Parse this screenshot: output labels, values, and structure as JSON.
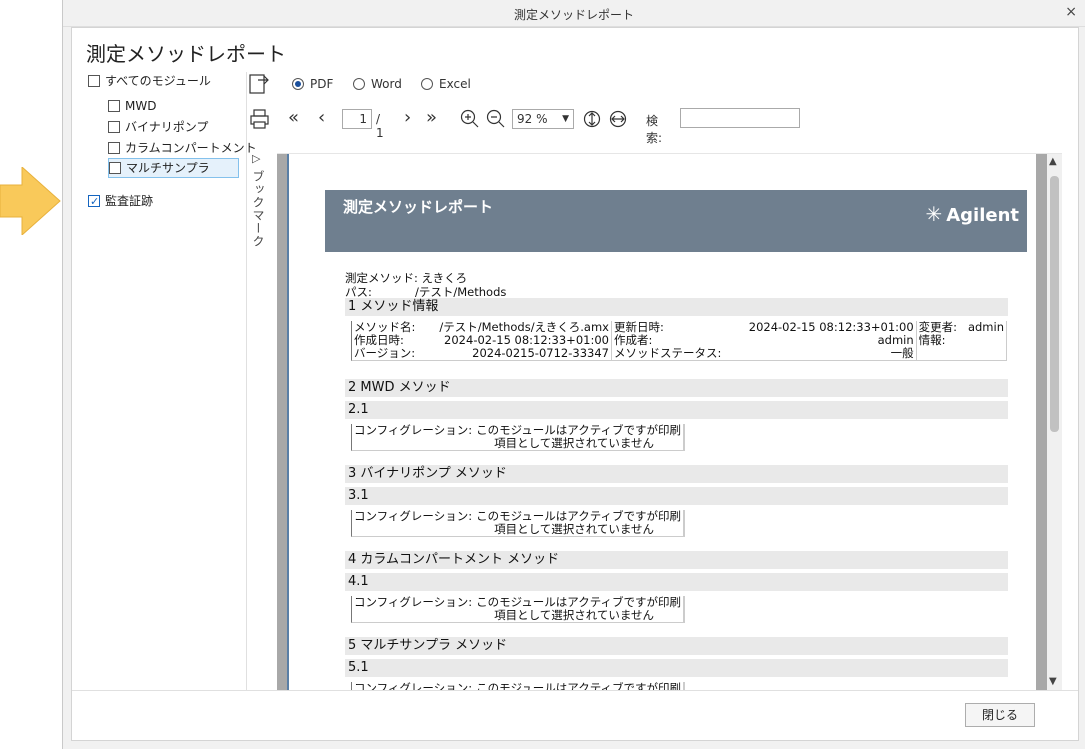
{
  "window": {
    "title": "測定メソッドレポート",
    "close_glyph": "×"
  },
  "header": {
    "title": "測定メソッドレポート"
  },
  "tree": {
    "all_modules": "すべてのモジュール",
    "items": [
      "MWD",
      "バイナリポンプ",
      "カラムコンパートメント",
      "マルチサンプラ"
    ],
    "audit_trail": "監査証跡"
  },
  "format": {
    "pdf": "PDF",
    "word": "Word",
    "excel": "Excel",
    "selected": "PDF"
  },
  "nav": {
    "page_value": "1",
    "page_total": "/ 1",
    "zoom": "92 %",
    "search_label": "検索:",
    "search_value": ""
  },
  "bookmark": {
    "label": "ブックマーク"
  },
  "report": {
    "banner_title": "測定メソッドレポート",
    "logo_text": "Agilent",
    "method_label": "測定メソッド:",
    "method_value": "えきくろ",
    "path_label": "パス:",
    "path_value": "/テスト/Methods",
    "sec1": "1 メソッド情報",
    "info": {
      "r1": [
        "メソッド名:",
        "/テスト/Methods/えきくろ.amx",
        "更新日時:",
        "2024-02-15 08:12:33+01:00",
        "変更者:",
        "admin"
      ],
      "r2": [
        "作成日時:",
        "2024-02-15 08:12:33+01:00",
        "作成者:",
        "admin",
        "情報:",
        ""
      ],
      "r3": [
        "バージョン:",
        "2024-0215-0712-33347",
        "メソッドステータス:",
        "一般",
        "",
        ""
      ]
    },
    "sec2": "2 MWD メソッド",
    "sec2_1": "2.1",
    "sec3": "3 バイナリポンプ メソッド",
    "sec3_1": "3.1",
    "sec4": "4 カラムコンパートメント メソッド",
    "sec4_1": "4.1",
    "sec5": "5 マルチサンプラ メソッド",
    "sec5_1": "5.1",
    "config_label": "コンフィグレーション:",
    "config_text1": "このモジュールはアクティブですが印刷",
    "config_text2": "項目として選択されていません"
  },
  "footer": {
    "close_label": "閉じる"
  },
  "colors": {
    "banner": "#6f7f8f",
    "accent": "#1565c0",
    "arrow": "#f9c95a"
  }
}
